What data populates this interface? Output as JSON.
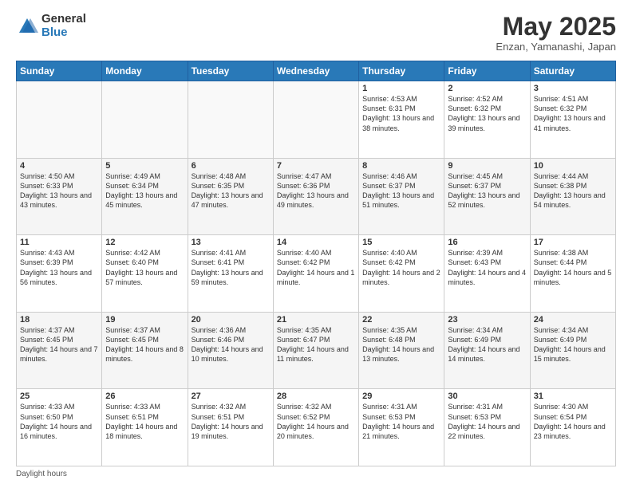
{
  "header": {
    "logo_general": "General",
    "logo_blue": "Blue",
    "month_year": "May 2025",
    "location": "Enzan, Yamanashi, Japan"
  },
  "days_of_week": [
    "Sunday",
    "Monday",
    "Tuesday",
    "Wednesday",
    "Thursday",
    "Friday",
    "Saturday"
  ],
  "footer": {
    "note": "Daylight hours"
  },
  "weeks": [
    {
      "days": [
        {
          "num": "",
          "info": ""
        },
        {
          "num": "",
          "info": ""
        },
        {
          "num": "",
          "info": ""
        },
        {
          "num": "",
          "info": ""
        },
        {
          "num": "1",
          "info": "Sunrise: 4:53 AM\nSunset: 6:31 PM\nDaylight: 13 hours\nand 38 minutes."
        },
        {
          "num": "2",
          "info": "Sunrise: 4:52 AM\nSunset: 6:32 PM\nDaylight: 13 hours\nand 39 minutes."
        },
        {
          "num": "3",
          "info": "Sunrise: 4:51 AM\nSunset: 6:32 PM\nDaylight: 13 hours\nand 41 minutes."
        }
      ]
    },
    {
      "days": [
        {
          "num": "4",
          "info": "Sunrise: 4:50 AM\nSunset: 6:33 PM\nDaylight: 13 hours\nand 43 minutes."
        },
        {
          "num": "5",
          "info": "Sunrise: 4:49 AM\nSunset: 6:34 PM\nDaylight: 13 hours\nand 45 minutes."
        },
        {
          "num": "6",
          "info": "Sunrise: 4:48 AM\nSunset: 6:35 PM\nDaylight: 13 hours\nand 47 minutes."
        },
        {
          "num": "7",
          "info": "Sunrise: 4:47 AM\nSunset: 6:36 PM\nDaylight: 13 hours\nand 49 minutes."
        },
        {
          "num": "8",
          "info": "Sunrise: 4:46 AM\nSunset: 6:37 PM\nDaylight: 13 hours\nand 51 minutes."
        },
        {
          "num": "9",
          "info": "Sunrise: 4:45 AM\nSunset: 6:37 PM\nDaylight: 13 hours\nand 52 minutes."
        },
        {
          "num": "10",
          "info": "Sunrise: 4:44 AM\nSunset: 6:38 PM\nDaylight: 13 hours\nand 54 minutes."
        }
      ]
    },
    {
      "days": [
        {
          "num": "11",
          "info": "Sunrise: 4:43 AM\nSunset: 6:39 PM\nDaylight: 13 hours\nand 56 minutes."
        },
        {
          "num": "12",
          "info": "Sunrise: 4:42 AM\nSunset: 6:40 PM\nDaylight: 13 hours\nand 57 minutes."
        },
        {
          "num": "13",
          "info": "Sunrise: 4:41 AM\nSunset: 6:41 PM\nDaylight: 13 hours\nand 59 minutes."
        },
        {
          "num": "14",
          "info": "Sunrise: 4:40 AM\nSunset: 6:42 PM\nDaylight: 14 hours\nand 1 minute."
        },
        {
          "num": "15",
          "info": "Sunrise: 4:40 AM\nSunset: 6:42 PM\nDaylight: 14 hours\nand 2 minutes."
        },
        {
          "num": "16",
          "info": "Sunrise: 4:39 AM\nSunset: 6:43 PM\nDaylight: 14 hours\nand 4 minutes."
        },
        {
          "num": "17",
          "info": "Sunrise: 4:38 AM\nSunset: 6:44 PM\nDaylight: 14 hours\nand 5 minutes."
        }
      ]
    },
    {
      "days": [
        {
          "num": "18",
          "info": "Sunrise: 4:37 AM\nSunset: 6:45 PM\nDaylight: 14 hours\nand 7 minutes."
        },
        {
          "num": "19",
          "info": "Sunrise: 4:37 AM\nSunset: 6:45 PM\nDaylight: 14 hours\nand 8 minutes."
        },
        {
          "num": "20",
          "info": "Sunrise: 4:36 AM\nSunset: 6:46 PM\nDaylight: 14 hours\nand 10 minutes."
        },
        {
          "num": "21",
          "info": "Sunrise: 4:35 AM\nSunset: 6:47 PM\nDaylight: 14 hours\nand 11 minutes."
        },
        {
          "num": "22",
          "info": "Sunrise: 4:35 AM\nSunset: 6:48 PM\nDaylight: 14 hours\nand 13 minutes."
        },
        {
          "num": "23",
          "info": "Sunrise: 4:34 AM\nSunset: 6:49 PM\nDaylight: 14 hours\nand 14 minutes."
        },
        {
          "num": "24",
          "info": "Sunrise: 4:34 AM\nSunset: 6:49 PM\nDaylight: 14 hours\nand 15 minutes."
        }
      ]
    },
    {
      "days": [
        {
          "num": "25",
          "info": "Sunrise: 4:33 AM\nSunset: 6:50 PM\nDaylight: 14 hours\nand 16 minutes."
        },
        {
          "num": "26",
          "info": "Sunrise: 4:33 AM\nSunset: 6:51 PM\nDaylight: 14 hours\nand 18 minutes."
        },
        {
          "num": "27",
          "info": "Sunrise: 4:32 AM\nSunset: 6:51 PM\nDaylight: 14 hours\nand 19 minutes."
        },
        {
          "num": "28",
          "info": "Sunrise: 4:32 AM\nSunset: 6:52 PM\nDaylight: 14 hours\nand 20 minutes."
        },
        {
          "num": "29",
          "info": "Sunrise: 4:31 AM\nSunset: 6:53 PM\nDaylight: 14 hours\nand 21 minutes."
        },
        {
          "num": "30",
          "info": "Sunrise: 4:31 AM\nSunset: 6:53 PM\nDaylight: 14 hours\nand 22 minutes."
        },
        {
          "num": "31",
          "info": "Sunrise: 4:30 AM\nSunset: 6:54 PM\nDaylight: 14 hours\nand 23 minutes."
        }
      ]
    }
  ]
}
